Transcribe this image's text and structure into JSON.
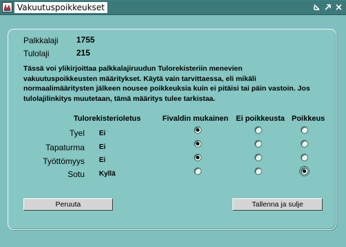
{
  "window": {
    "title": "Vakuutuspoikkeukset",
    "controls": [
      "minimize-icon",
      "maximize-icon",
      "close-icon"
    ]
  },
  "header": {
    "palkkalaji_label": "Palkkalaji",
    "palkkalaji_value": "1755",
    "tulolaji_label": "Tulolaji",
    "tulolaji_value": "215"
  },
  "description": "Tässä voi ylikirjoittaa palkkalajiruudun Tulorekisteriin menevien vakuutuspoikkeusten määritykset. Käytä vain tarvittaessa, eli mikäli normaalimääritysten jälkeen nousee poikkeuksia kuin ei pitäisi tai päin vastoin. Jos tulolajilinkitys muutetaan, tämä määritys tulee tarkistaa.",
  "table": {
    "columns": [
      "Tulorekisterioletus",
      "Fivaldin mukainen",
      "Ei poikkeusta",
      "Poikkeus"
    ],
    "rows": [
      {
        "label": "Tyel",
        "default": "Ei",
        "selected": 0
      },
      {
        "label": "Tapaturma",
        "default": "Ei",
        "selected": 0
      },
      {
        "label": "Työttömyys",
        "default": "Ei",
        "selected": 0
      },
      {
        "label": "Sotu",
        "default": "Kyllä",
        "selected": 2
      }
    ]
  },
  "buttons": {
    "cancel": "Peruuta",
    "save_close": "Tallenna ja sulje"
  },
  "colors": {
    "background": "#7fbfbd",
    "panel": "#86c6c3",
    "titlebar": "#3f7f7f"
  }
}
